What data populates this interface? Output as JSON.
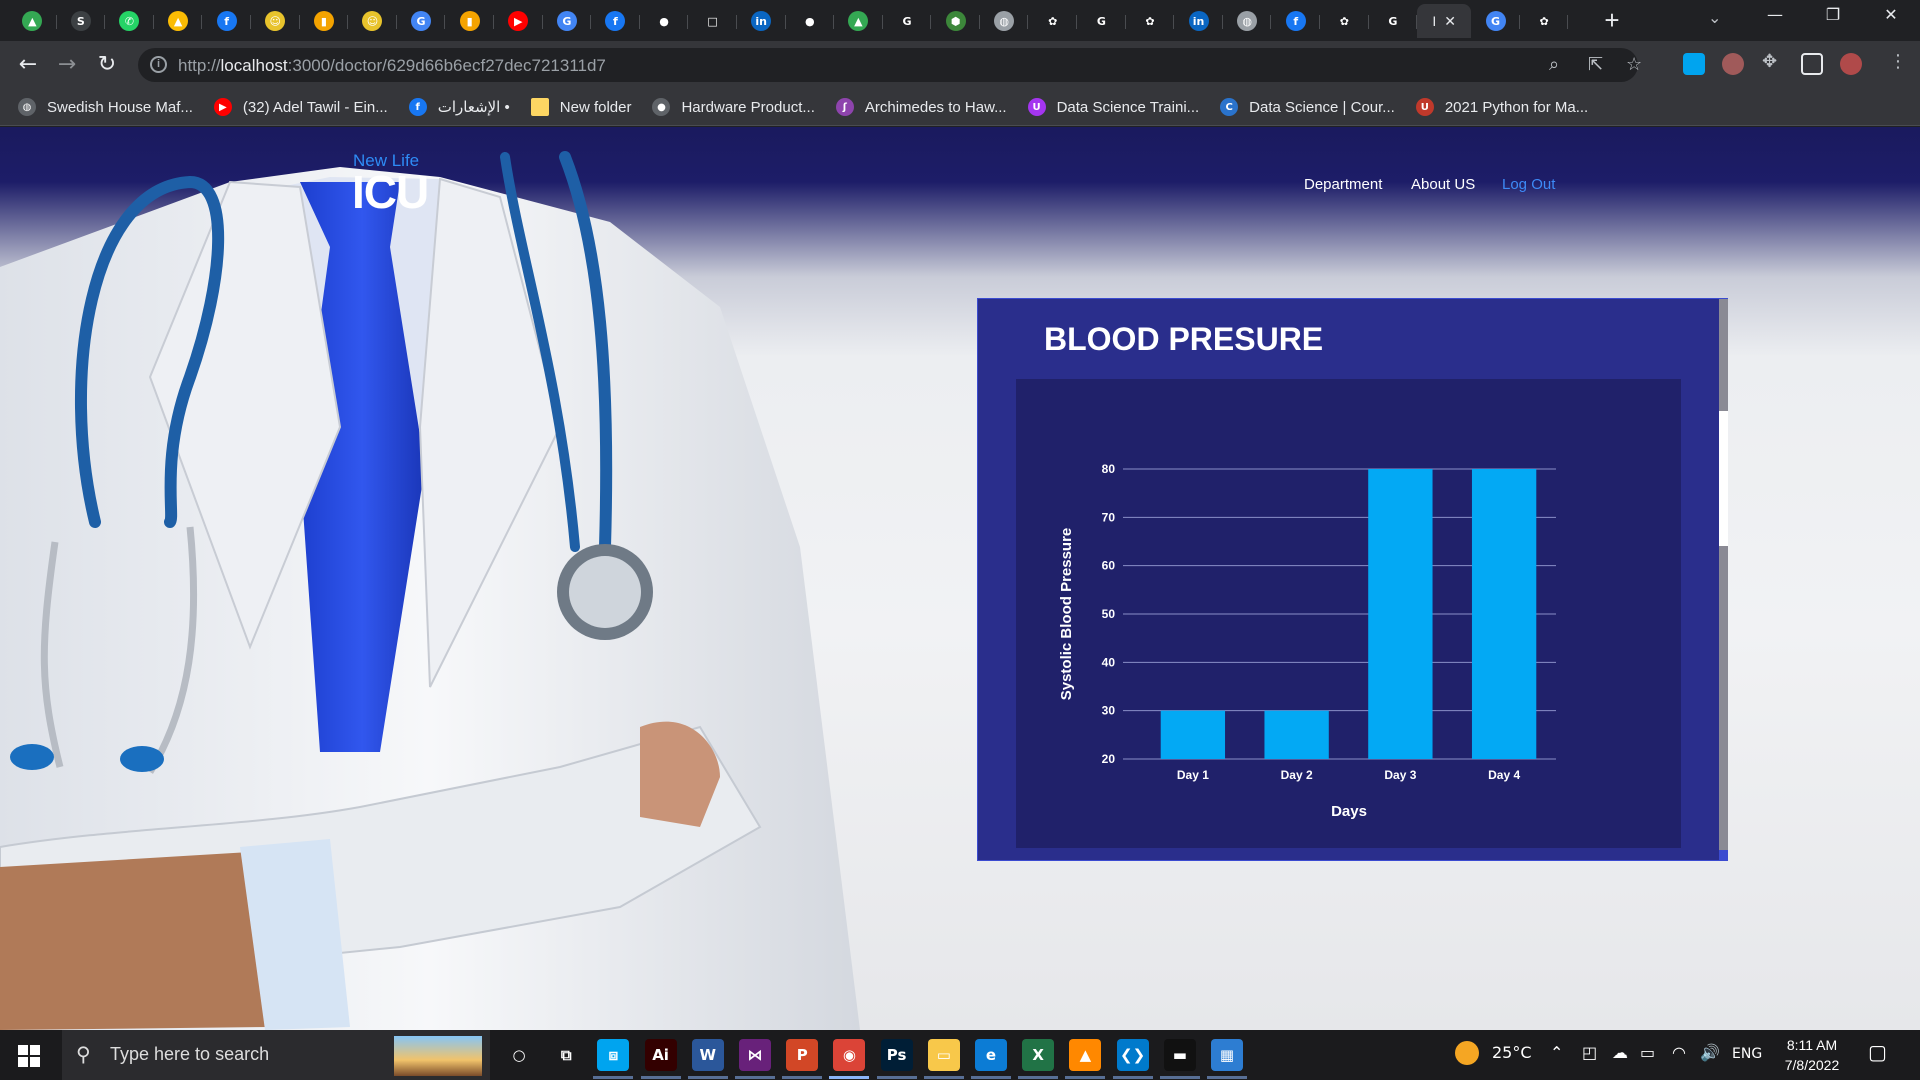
{
  "browser": {
    "tabs": [
      {
        "icon": "google-drive-icon",
        "color": "#34a853",
        "glyph": "▲"
      },
      {
        "icon": "smd-icon",
        "color": "#3c4043",
        "glyph": "S"
      },
      {
        "icon": "whatsapp-icon",
        "color": "#25d366",
        "glyph": "✆"
      },
      {
        "icon": "google-drive-icon",
        "color": "#fbbc04",
        "glyph": "▲"
      },
      {
        "icon": "facebook-icon",
        "color": "#1877f2",
        "glyph": "f"
      },
      {
        "icon": "smiley-icon",
        "color": "#e8c32c",
        "glyph": "☺"
      },
      {
        "icon": "bar-chart-icon",
        "color": "#f4a300",
        "glyph": "▮"
      },
      {
        "icon": "smiley-icon",
        "color": "#e8c32c",
        "glyph": "☺"
      },
      {
        "icon": "translate-icon",
        "color": "#4285f4",
        "glyph": "G"
      },
      {
        "icon": "bar-chart-icon",
        "color": "#f4a300",
        "glyph": "▮"
      },
      {
        "icon": "youtube-icon",
        "color": "#ff0000",
        "glyph": "▶"
      },
      {
        "icon": "translate-icon",
        "color": "#4285f4",
        "glyph": "G"
      },
      {
        "icon": "facebook-icon",
        "color": "#1877f2",
        "glyph": "f"
      },
      {
        "icon": "github-icon",
        "color": "#ffffff",
        "glyph": "●"
      },
      {
        "icon": "page-icon",
        "color": "#ffffff",
        "glyph": "□"
      },
      {
        "icon": "linkedin-icon",
        "color": "#0a66c2",
        "glyph": "in"
      },
      {
        "icon": "github-icon",
        "color": "#ffffff",
        "glyph": "●"
      },
      {
        "icon": "google-drive-icon",
        "color": "#34a853",
        "glyph": "▲"
      },
      {
        "icon": "google-icon",
        "color": "#ffffff",
        "glyph": "G"
      },
      {
        "icon": "nodejs-icon",
        "color": "#3c873a",
        "glyph": "⬢"
      },
      {
        "icon": "globe-icon",
        "color": "#9aa0a6",
        "glyph": "◍"
      },
      {
        "icon": "openai-icon",
        "color": "#ffffff",
        "glyph": "✿"
      },
      {
        "icon": "google-icon",
        "color": "#ffffff",
        "glyph": "G"
      },
      {
        "icon": "openai-icon",
        "color": "#ffffff",
        "glyph": "✿"
      },
      {
        "icon": "linkedin-icon",
        "color": "#0a66c2",
        "glyph": "in"
      },
      {
        "icon": "globe-icon",
        "color": "#9aa0a6",
        "glyph": "◍"
      },
      {
        "icon": "facebook-icon",
        "color": "#1877f2",
        "glyph": "f"
      },
      {
        "icon": "openai-icon",
        "color": "#ffffff",
        "glyph": "✿"
      },
      {
        "icon": "google-icon",
        "color": "#ffffff",
        "glyph": "G"
      }
    ],
    "active_tab_label": "I",
    "after_tabs": [
      {
        "icon": "translate-icon",
        "color": "#4285f4",
        "glyph": "G"
      },
      {
        "icon": "openai-icon",
        "color": "#ffffff",
        "glyph": "✿"
      }
    ],
    "url_scheme": "http://",
    "url_host": "localhost",
    "url_path": ":3000/doctor/629d66b6ecf27dec721311d7"
  },
  "bookmarks": [
    {
      "label": "Swedish House Maf...",
      "icon": "globe-icon",
      "color": "#5f6368",
      "glyph": "◍"
    },
    {
      "label": "(32) Adel Tawil - Ein...",
      "icon": "youtube-icon",
      "color": "#ff0000",
      "glyph": "▶"
    },
    {
      "label": "الإشعارات •",
      "icon": "facebook-icon",
      "color": "#1877f2",
      "glyph": "f"
    },
    {
      "label": "New folder",
      "icon": "folder-icon",
      "color": "#fdd663",
      "glyph": ""
    },
    {
      "label": "Hardware Product...",
      "icon": "apple-icon",
      "color": "#5f6368",
      "glyph": "●"
    },
    {
      "label": "Archimedes to Haw...",
      "icon": "feather-icon",
      "color": "#8e44ad",
      "glyph": "ʃ"
    },
    {
      "label": "Data Science Traini...",
      "icon": "udemy-icon",
      "color": "#a435f0",
      "glyph": "U"
    },
    {
      "label": "Data Science | Cour...",
      "icon": "coursera-icon",
      "color": "#2a73cc",
      "glyph": "C"
    },
    {
      "label": "2021 Python for Ma...",
      "icon": "udemy-icon",
      "color": "#c0392b",
      "glyph": "U"
    }
  ],
  "site": {
    "logo_small": "New Life",
    "logo_big": "ICU",
    "nav": [
      "Department",
      "About US",
      "Log Out"
    ]
  },
  "card": {
    "title": "BLOOD PRESURE"
  },
  "chart_data": {
    "type": "bar",
    "title": "",
    "categories": [
      "Day 1",
      "Day 2",
      "Day 3",
      "Day 4"
    ],
    "values": [
      30,
      30,
      80,
      80
    ],
    "xlabel": "Days",
    "ylabel": "Systolic Blood Pressure",
    "ylim": [
      20,
      80
    ],
    "yticks": [
      20,
      30,
      40,
      50,
      60,
      70,
      80
    ],
    "grid": true,
    "bar_color": "#03a9f4",
    "axis_text_color": "#ffffff",
    "background": "#20216a"
  },
  "taskbar": {
    "search_placeholder": "Type here to search",
    "apps": [
      {
        "icon": "cortana-icon",
        "color": "transparent",
        "glyph": "○"
      },
      {
        "icon": "task-view-icon",
        "color": "transparent",
        "glyph": "⧉"
      },
      {
        "icon": "remote-desktop-icon",
        "color": "#00a4ef",
        "glyph": "⧈"
      },
      {
        "icon": "illustrator-icon",
        "color": "#330000",
        "glyph": "Ai"
      },
      {
        "icon": "word-icon",
        "color": "#2b579a",
        "glyph": "W"
      },
      {
        "icon": "visual-studio-icon",
        "color": "#68217a",
        "glyph": "⋈"
      },
      {
        "icon": "powerpoint-icon",
        "color": "#d24726",
        "glyph": "P"
      },
      {
        "icon": "chrome-icon",
        "color": "#db4437",
        "glyph": "◉"
      },
      {
        "icon": "photoshop-icon",
        "color": "#001e36",
        "glyph": "Ps"
      },
      {
        "icon": "file-explorer-icon",
        "color": "#f8c84a",
        "glyph": "▭"
      },
      {
        "icon": "edge-icon",
        "color": "#0c7cd5",
        "glyph": "e"
      },
      {
        "icon": "excel-icon",
        "color": "#217346",
        "glyph": "X"
      },
      {
        "icon": "vlc-icon",
        "color": "#ff8800",
        "glyph": "▲"
      },
      {
        "icon": "vscode-icon",
        "color": "#007acc",
        "glyph": "❮❯"
      },
      {
        "icon": "terminal-icon",
        "color": "#111111",
        "glyph": "▬"
      },
      {
        "icon": "photos-icon",
        "color": "#2d7dd2",
        "glyph": "▦"
      }
    ],
    "weather_temp": "25°C",
    "language": "ENG",
    "time": "8:11 AM",
    "date": "7/8/2022"
  }
}
